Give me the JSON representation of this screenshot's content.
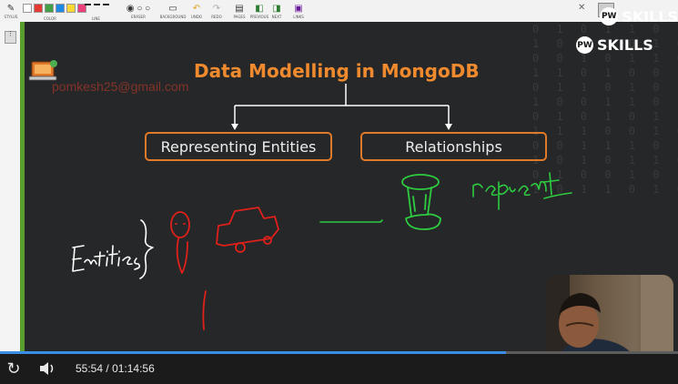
{
  "toolbar": {
    "items": [
      {
        "label": "STYLUS",
        "icon": "stylus-icon"
      },
      {
        "label": "COLOR",
        "icon": "color-icon"
      },
      {
        "label": "LINE",
        "icon": "line-icon"
      },
      {
        "label": "ERASER",
        "icon": "eraser-icon"
      },
      {
        "label": "BACKGROUND",
        "icon": "background-icon"
      },
      {
        "label": "UNDO",
        "icon": "undo-icon"
      },
      {
        "label": "REDO",
        "icon": "redo-icon"
      },
      {
        "label": "PAGES",
        "icon": "pages-icon"
      },
      {
        "label": "PREVIOUS",
        "icon": "previous-icon"
      },
      {
        "label": "NEXT",
        "icon": "next-icon"
      },
      {
        "label": "LINKS",
        "icon": "links-icon"
      }
    ],
    "colors": [
      "#ffffff",
      "#e53935",
      "#43a047",
      "#1e88e5",
      "#fdd835",
      "#ec407a"
    ]
  },
  "brand": {
    "name": "SKILLS",
    "mark": "PW"
  },
  "board": {
    "title": "Data Modelling in MongoDB",
    "email_watermark": "pomkesh25@gmail.com",
    "boxes": [
      "Representing Entities",
      "Relationships"
    ],
    "handwriting": {
      "left": "Entities",
      "right": "represent"
    },
    "binary_rows": [
      "0 1 0 1 1 0 1 0 1",
      "1 0 1 1 0 1 0 0 0",
      "0 0 1 0 1 1 0 1 1",
      "1 1 0 1 0 0 1 1 0",
      "0 1 1 0 1 0 1 0 1",
      "1 0 0 1 1 0 1 1 0",
      "0 1 0 1 0 1 1 0 1",
      "1 1 1 0 0 1 0 1 0",
      "0 0 1 1 1 0 1 0 1",
      "1 0 1 0 1 1 0 0 0",
      "0 1 0 0 1 0 1 1 1",
      "1 0 1 1 0 1 0 1 0"
    ]
  },
  "player": {
    "current_time": "55:54",
    "separator": "/",
    "total_time": "01:14:56",
    "progress": 0.746,
    "accent": "#3a8ee6"
  }
}
